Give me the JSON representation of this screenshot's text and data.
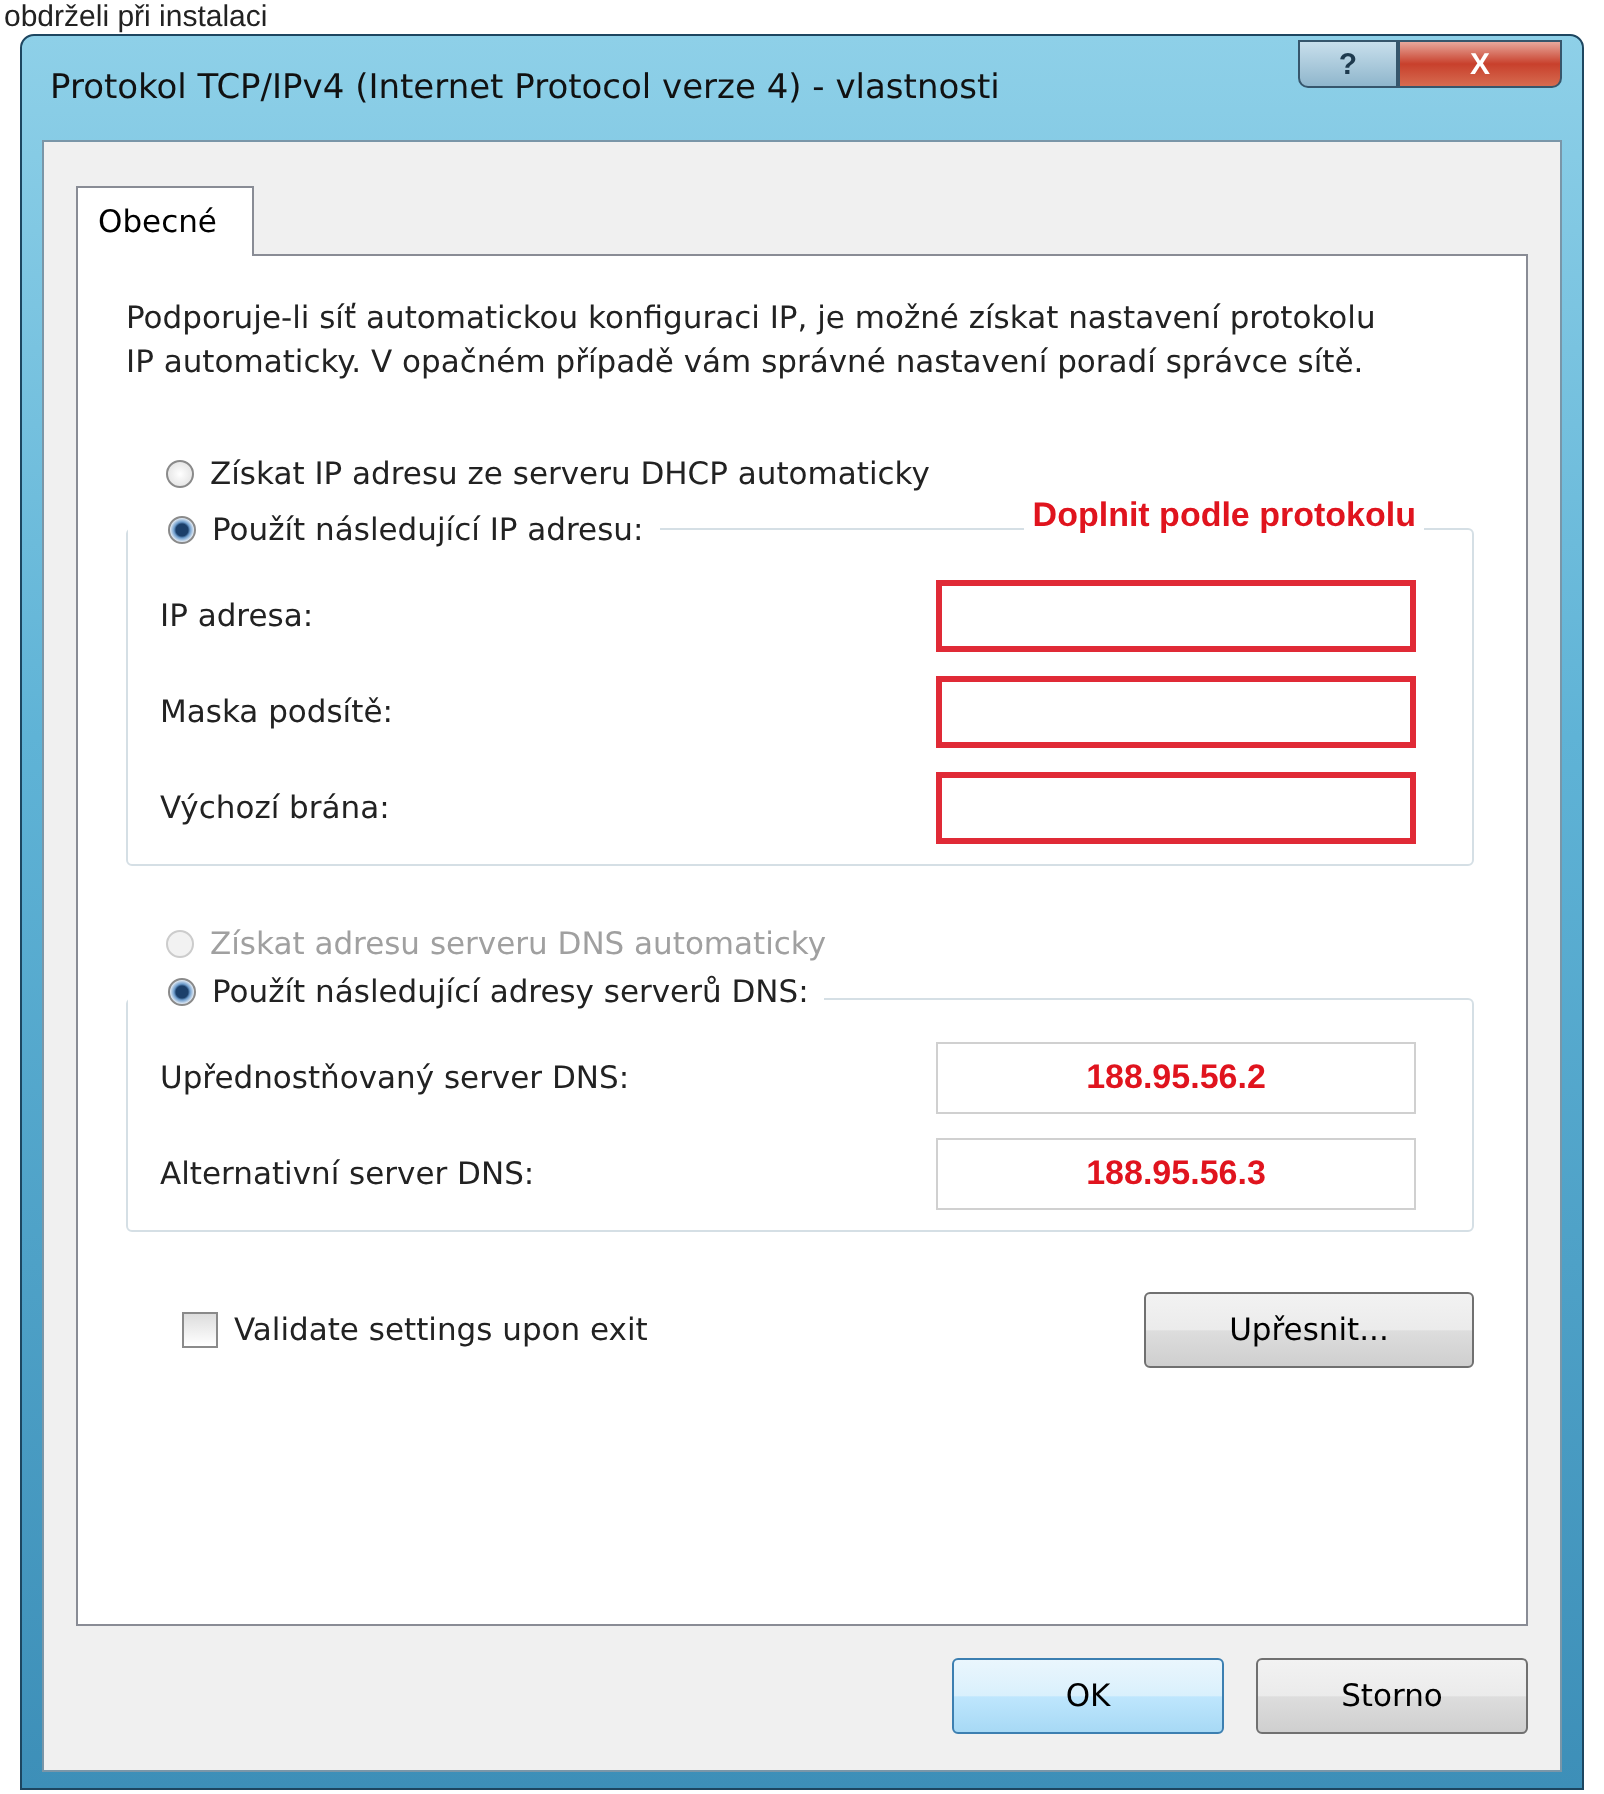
{
  "top_text": "obdrželi při instalaci",
  "window": {
    "title": "Protokol TCP/IPv4 (Internet Protocol verze 4) - vlastnosti",
    "help": "?",
    "close": "X"
  },
  "tabs": [
    {
      "label": "Obecné",
      "selected": true
    }
  ],
  "description": "Podporuje-li síť automatickou konfiguraci IP, je možné získat nastavení protokolu IP automaticky. V opačném případě vám správné nastavení poradí správce sítě.",
  "sections": [
    {
      "auto_option": {
        "label": "Získat IP adresu ze serveru DHCP automaticky",
        "selected": false,
        "disabled": false
      },
      "manual_option": {
        "label": "Použít následující IP adresu:",
        "selected": true,
        "disabled": false
      },
      "annotation": "Doplnit podle protokolu",
      "fields": [
        {
          "label": "IP adresa:",
          "highlighted": true
        },
        {
          "label": "Maska podsítě:",
          "highlighted": true
        },
        {
          "label": "Výchozí brána:",
          "highlighted": true
        }
      ]
    },
    {
      "auto_option": {
        "label": "Získat adresu serveru DNS automaticky",
        "selected": false,
        "disabled": true
      },
      "manual_option": {
        "label": "Použít následující adresy serverů DNS:",
        "selected": true,
        "disabled": false
      },
      "fields": [
        {
          "label": "Upřednostňovaný server DNS:",
          "value": "188.95.56.2",
          "highlighted": false
        },
        {
          "label": "Alternativní server DNS:",
          "value": "188.95.56.3",
          "highlighted": false
        }
      ]
    }
  ],
  "validate": {
    "label": "Validate settings upon exit",
    "checked": false
  },
  "advanced_button": "Upřesnit...",
  "dialog_buttons": [
    {
      "label": "OK",
      "default": true
    },
    {
      "label": "Storno",
      "default": false
    }
  ]
}
